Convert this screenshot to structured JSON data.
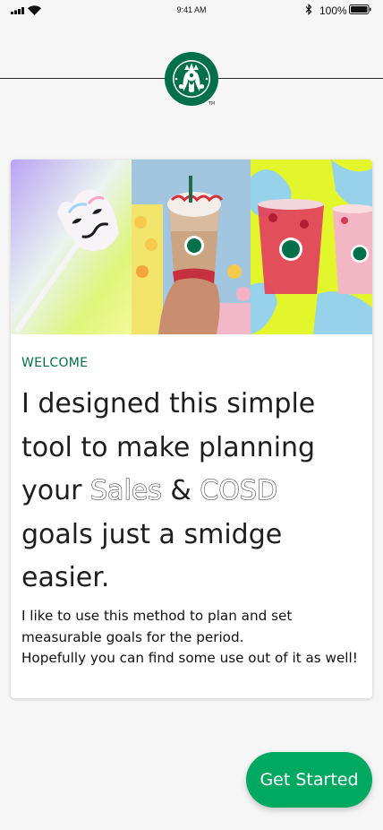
{
  "status_bar": {
    "time": "9:41 AM",
    "battery_percent": "100%",
    "icons": [
      "signal-icon",
      "wifi-icon",
      "bluetooth-icon",
      "battery-icon"
    ]
  },
  "header": {
    "logo": "starbucks-siren-logo",
    "logo_mark": "TM",
    "brand_color": "#00704a"
  },
  "hero": {
    "panels": [
      "cake-pop-image",
      "frappuccino-image",
      "refresher-drinks-image"
    ]
  },
  "card": {
    "eyebrow": "WELCOME",
    "headline": {
      "line1": "I designed this simple",
      "line2": "tool to make planning",
      "line3_prefix": "your",
      "line3_sales": "Sales",
      "line3_amp": "&",
      "line3_cosd": "COSD",
      "line4": "goals just a smidge",
      "line5": "easier."
    },
    "body": {
      "line1": "I like to use this method to plan and set",
      "line2": "measurable goals for the period.",
      "line3": "Hopefully you can find some use out of it as well!"
    }
  },
  "cta": {
    "label": "Get Started",
    "color": "#00a862"
  }
}
